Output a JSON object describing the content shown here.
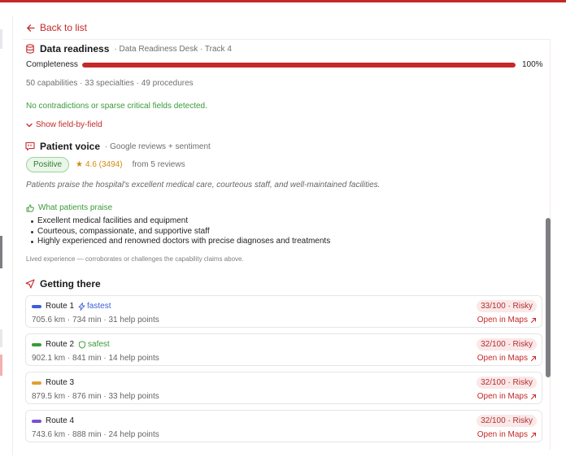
{
  "nav": {
    "back_label": "Back to list"
  },
  "readiness": {
    "title": "Data readiness",
    "subtitle": "· Data Readiness Desk · Track 4",
    "completeness_label": "Completeness",
    "completeness_value": "100%",
    "completeness_fraction": 1.0,
    "stats": "50 capabilities · 33 specialties · 49 procedures",
    "status_message": "No contradictions or sparse critical fields detected.",
    "toggle_label": "Show field-by-field"
  },
  "patient_voice": {
    "title": "Patient voice",
    "subtitle": "· Google reviews + sentiment",
    "sentiment": "Positive",
    "rating": "4.6 (3494)",
    "reviews": "from 5 reviews",
    "summary": "Patients praise the hospital's excellent medical care, courteous staff, and well-maintained facilities.",
    "praise_title": "What patients praise",
    "praise_items": [
      "Excellent medical facilities and equipment",
      "Courteous, compassionate, and supportive staff",
      "Highly experienced and renowned doctors with precise diagnoses and treatments"
    ],
    "note": "Lived experience — corroborates or challenges the capability claims above."
  },
  "getting_there": {
    "title": "Getting there",
    "routes": [
      {
        "name": "Route 1",
        "tag": "fastest",
        "tag_icon": "bolt-icon",
        "color": "#3b5fd9",
        "tag_color": "#3b5fd9",
        "details": "705.6 km · 734 min · 31 help points",
        "risk": "33/100 · Risky",
        "maps_label": "Open in Maps"
      },
      {
        "name": "Route 2",
        "tag": "safest",
        "tag_icon": "shield-icon",
        "color": "#3a9a3a",
        "tag_color": "#3a9a3a",
        "details": "902.1 km · 841 min · 14 help points",
        "risk": "32/100 · Risky",
        "maps_label": "Open in Maps"
      },
      {
        "name": "Route 3",
        "tag": "",
        "color": "#e0a030",
        "tag_color": "",
        "details": "879.5 km · 876 min · 33 help points",
        "risk": "32/100 · Risky",
        "maps_label": "Open in Maps"
      },
      {
        "name": "Route 4",
        "tag": "",
        "color": "#7b4fd0",
        "tag_color": "",
        "details": "743.6 km · 888 min · 24 help points",
        "risk": "32/100 · Risky",
        "maps_label": "Open in Maps"
      }
    ]
  },
  "colors": {
    "accent": "#c62828",
    "success": "#3a9a3a",
    "rating": "#d18a12"
  }
}
